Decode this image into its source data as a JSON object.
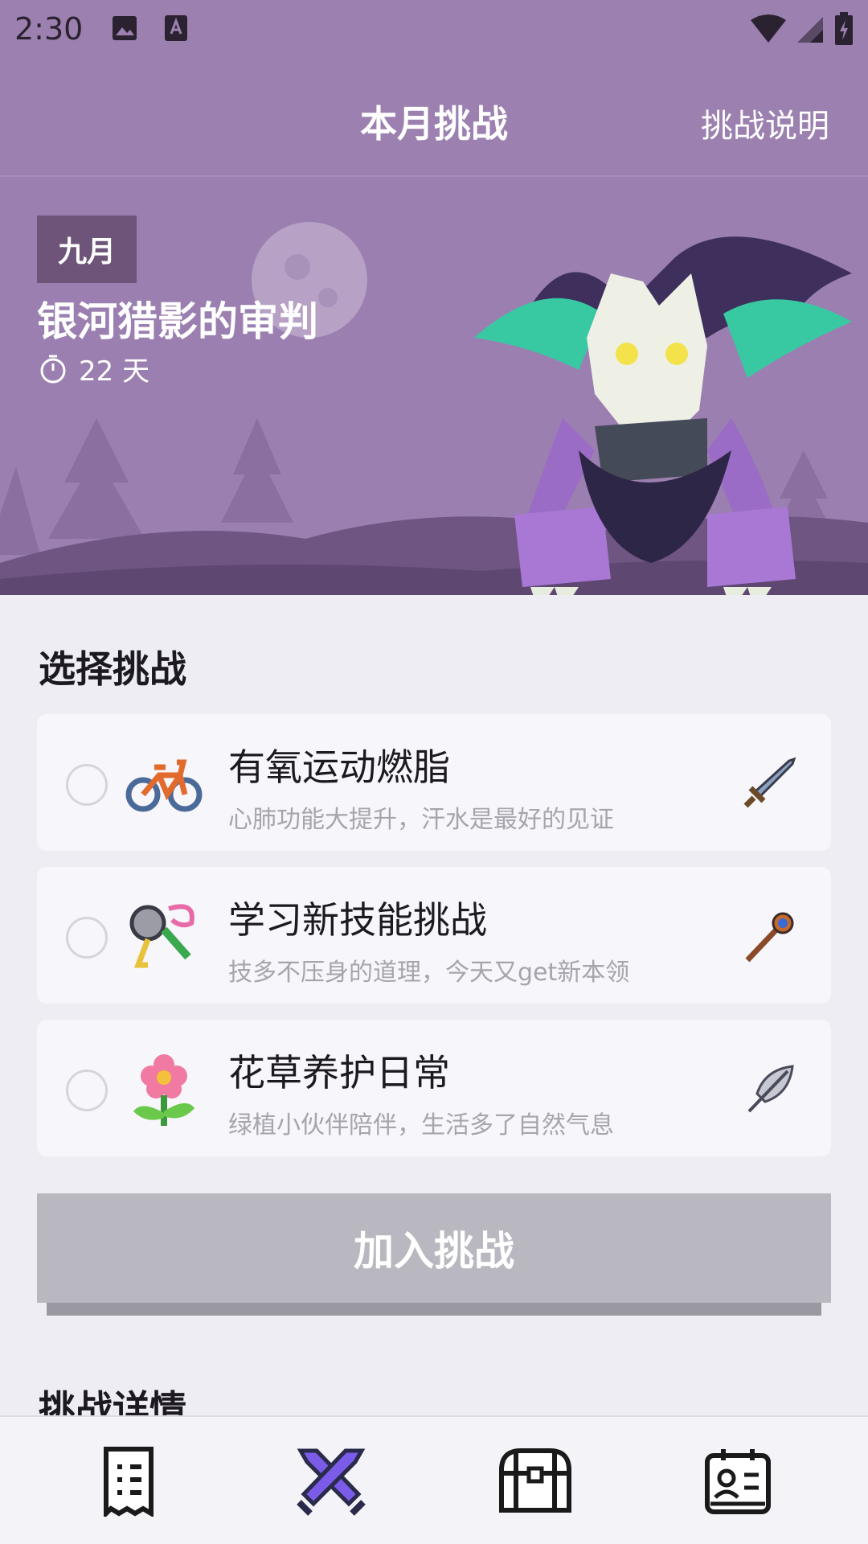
{
  "status_bar": {
    "time": "2:30"
  },
  "app_bar": {
    "title": "本月挑战",
    "action": "挑战说明"
  },
  "hero": {
    "month": "九月",
    "title": "银河猎影的审判",
    "days": "22 天"
  },
  "select_section": {
    "title": "选择挑战"
  },
  "challenges": [
    {
      "title": "有氧运动燃脂",
      "subtitle": "心肺功能大提升，汗水是最好的见证",
      "icon": "bicycle-icon",
      "weapon": "sword-icon"
    },
    {
      "title": "学习新技能挑战",
      "subtitle": "技多不压身的道理，今天又get新本领",
      "icon": "magnifier-key-icon",
      "weapon": "staff-icon"
    },
    {
      "title": "花草养护日常",
      "subtitle": "绿植小伙伴陪伴，生活多了自然气息",
      "icon": "flower-icon",
      "weapon": "feather-icon"
    }
  ],
  "join_button": {
    "label": "加入挑战"
  },
  "details_section": {
    "title": "挑战详情"
  },
  "bottom_nav": [
    {
      "icon": "document-icon",
      "active": false
    },
    {
      "icon": "crossed-swords-icon",
      "active": true
    },
    {
      "icon": "treasure-chest-icon",
      "active": false
    },
    {
      "icon": "profile-card-icon",
      "active": false
    }
  ],
  "colors": {
    "primary": "#9c80b0",
    "accent": "#7b5ce8",
    "disabled_button": "#b9b8c0"
  }
}
